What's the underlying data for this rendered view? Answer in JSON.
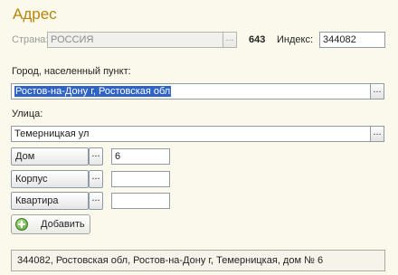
{
  "form": {
    "title": "Адрес"
  },
  "country": {
    "label": "Страна:",
    "value": "РОССИЯ",
    "code": "643"
  },
  "index": {
    "label": "Индекс:",
    "value": "344082"
  },
  "city": {
    "label": "Город, населенный пункт:",
    "value": "Ростов-на-Дону г, Ростовская обл"
  },
  "street": {
    "label": "Улица:",
    "value": "Темерницкая ул"
  },
  "house": {
    "type": "Дом",
    "value": "6"
  },
  "building": {
    "type": "Корпус",
    "value": ""
  },
  "apartment": {
    "type": "Квартира",
    "value": ""
  },
  "buttons": {
    "add": "Добавить",
    "choose": "..."
  },
  "summary": {
    "text": "344082, Ростовская обл, Ростов-на-Дону г, Темерницкая, дом № 6"
  }
}
